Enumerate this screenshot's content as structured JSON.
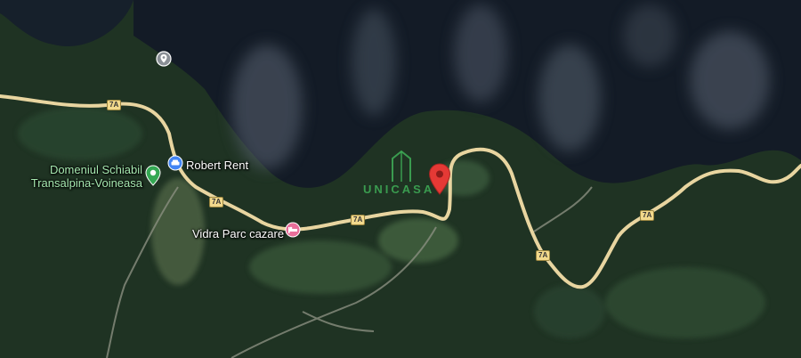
{
  "map": {
    "places": {
      "ski_domain": "Domeniul Schiabil\nTransalpina-Voineasa",
      "robert_rent": "Robert Rent",
      "vidra_parc": "Vidra Parc cazare"
    },
    "brand": "UNICASA",
    "road_shield": "7A",
    "colors": {
      "road": "#e8d5a0",
      "water": "#141c28",
      "forest": "#1f3323",
      "pin_red": "#e53935",
      "poi_green": "#34a853",
      "poi_blue": "#4285f4",
      "poi_pink": "#e86e9a"
    },
    "icons": [
      "location-pin-icon",
      "camera-icon",
      "park-icon",
      "car-rental-icon",
      "hotel-icon"
    ]
  }
}
